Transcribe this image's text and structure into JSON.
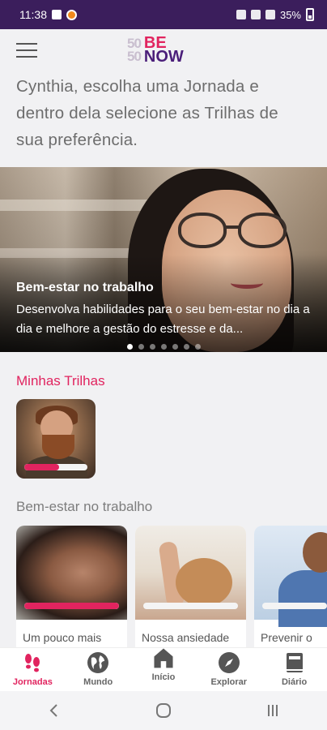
{
  "status_bar": {
    "time": "11:38",
    "battery": "35%"
  },
  "header": {
    "logo_5050_top": "50",
    "logo_5050_bottom": "50",
    "logo_be": "BE",
    "logo_now": "NOW"
  },
  "intro": {
    "text": "Cynthia, escolha uma Jornada e dentro dela selecione as Trilhas de sua preferência."
  },
  "hero": {
    "title": "Bem-estar no trabalho",
    "description": "Desenvolva habilidades para o seu bem-estar no dia a dia e melhore a gestão do estresse e da...",
    "slide_count": 7,
    "active_slide": 1
  },
  "minhas_trilhas": {
    "title": "Minhas Trilhas",
    "items": [
      {
        "progress": 0.55
      }
    ]
  },
  "bem_estar": {
    "title": "Bem-estar no trabalho",
    "cards": [
      {
        "label": "Um pouco mais",
        "progress": 1.0
      },
      {
        "label": "Nossa ansiedade",
        "progress": 0.0
      },
      {
        "label": "Prevenir o",
        "progress": 0.0
      }
    ]
  },
  "bottom_nav": {
    "items": [
      {
        "label": "Jornadas",
        "icon": "footprints-icon",
        "active": true
      },
      {
        "label": "Mundo",
        "icon": "globe-icon",
        "active": false
      },
      {
        "label": "Início",
        "icon": "home-icon",
        "active": false
      },
      {
        "label": "Explorar",
        "icon": "compass-icon",
        "active": false
      },
      {
        "label": "Diário",
        "icon": "book-icon",
        "active": false
      }
    ]
  },
  "colors": {
    "accent": "#e1245f",
    "brand_purple": "#4b1f7a",
    "status_bar": "#3b1e5c"
  }
}
